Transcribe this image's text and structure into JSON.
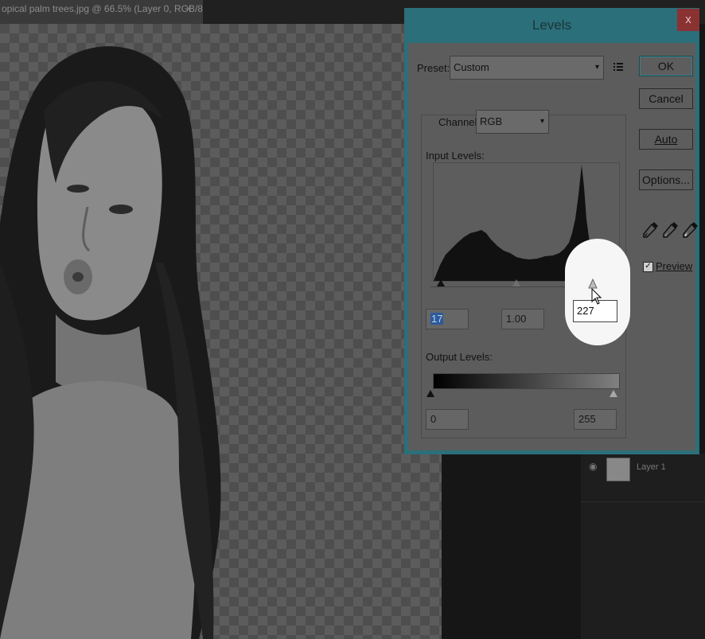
{
  "document_tab": {
    "title": "opical palm trees.jpg @ 66.5% (Layer 0, RGB/8)",
    "close_symbol": "×"
  },
  "layers": {
    "layer_name": "Layer 1",
    "visibility_icon": "eye-icon"
  },
  "dialog": {
    "title": "Levels",
    "close_symbol": "x",
    "preset_label": "Preset:",
    "preset_value": "Custom",
    "preset_menu_icon": "list-options-icon",
    "channel_label": "Channel:",
    "channel_value": "RGB",
    "input_levels_label": "Input Levels:",
    "input_black": "17",
    "input_gamma": "1.00",
    "input_white": "227",
    "output_levels_label": "Output Levels:",
    "output_black": "0",
    "output_white": "255",
    "buttons": {
      "ok": "OK",
      "cancel": "Cancel",
      "auto": "Auto",
      "options": "Options..."
    },
    "preview_label": "Preview",
    "preview_checked": true,
    "eyedroppers": [
      "black-eyedropper-icon",
      "gray-eyedropper-icon",
      "white-eyedropper-icon"
    ],
    "dropdown_arrow": "▾"
  },
  "colors": {
    "dialog_frame": "#2b6f7a",
    "dialog_body": "#5c5c5c",
    "close_button": "#8a3232",
    "highlight": "#2d5a9a"
  }
}
